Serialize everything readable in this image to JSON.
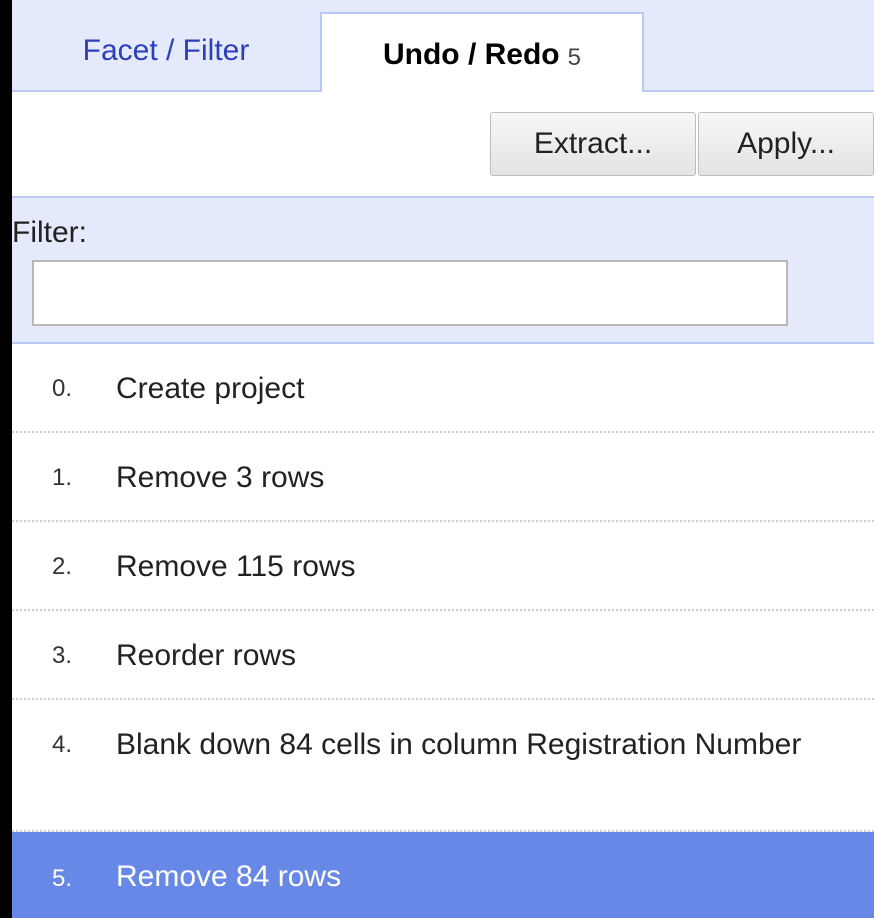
{
  "tabs": {
    "facet_filter": "Facet / Filter",
    "undo_redo": "Undo / Redo",
    "undo_redo_count": "5"
  },
  "toolbar": {
    "extract_label": "Extract...",
    "apply_label": "Apply..."
  },
  "filter": {
    "label": "Filter:",
    "value": ""
  },
  "history": [
    {
      "num": "0.",
      "label": "Create project"
    },
    {
      "num": "1.",
      "label": "Remove 3 rows"
    },
    {
      "num": "2.",
      "label": "Remove 115 rows"
    },
    {
      "num": "3.",
      "label": "Reorder rows"
    },
    {
      "num": "4.",
      "label": "Blank down 84 cells in column Registration Number"
    },
    {
      "num": "5.",
      "label": "Remove 84 rows"
    }
  ],
  "colors": {
    "selected_row": "#6888e8",
    "tab_bar": "#e4eafb",
    "tab_link": "#2a3fb8"
  }
}
